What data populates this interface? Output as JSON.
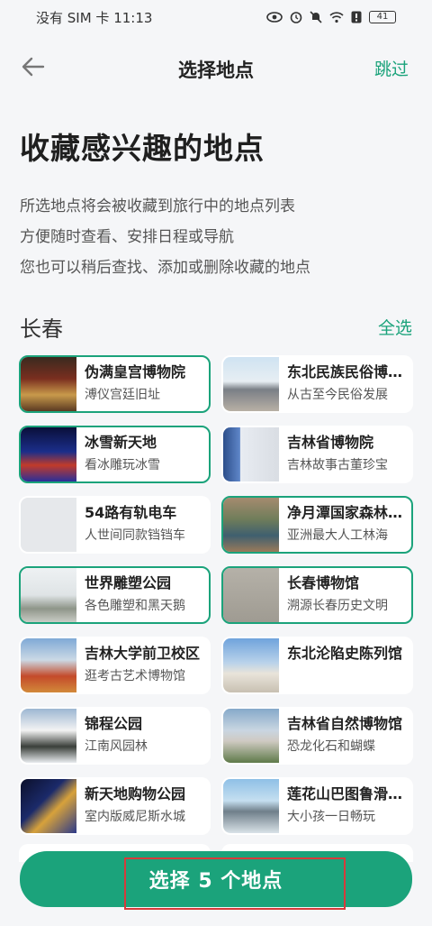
{
  "status": {
    "carrier_time": "没有 SIM 卡 11:13",
    "battery": "41"
  },
  "nav": {
    "title": "选择地点",
    "skip": "跳过"
  },
  "hero": {
    "title": "收藏感兴趣的地点",
    "desc": [
      "所选地点将会被收藏到旅行中的地点列表",
      "方便随时查看、安排日程或导航",
      "您也可以稍后查找、添加或删除收藏的地点"
    ]
  },
  "city": {
    "name": "长春",
    "select_all": "全选"
  },
  "places": [
    {
      "title": "伪满皇宫博物院",
      "sub": "溥仪宫廷旧址",
      "selected": true
    },
    {
      "title": "东北民族民俗博物馆",
      "sub": "从古至今民俗发展",
      "selected": false
    },
    {
      "title": "冰雪新天地",
      "sub": "看冰雕玩冰雪",
      "selected": true
    },
    {
      "title": "吉林省博物院",
      "sub": "吉林故事古董珍宝",
      "selected": false
    },
    {
      "title": "54路有轨电车",
      "sub": "人世间同款铛铛车",
      "selected": false
    },
    {
      "title": "净月潭国家森林公园",
      "sub": "亚洲最大人工林海",
      "selected": true
    },
    {
      "title": "世界雕塑公园",
      "sub": "各色雕塑和黑天鹅",
      "selected": true
    },
    {
      "title": "长春博物馆",
      "sub": "溯源长春历史文明",
      "selected": true
    },
    {
      "title": "吉林大学前卫校区",
      "sub": "逛考古艺术博物馆",
      "selected": false
    },
    {
      "title": "东北沦陷史陈列馆",
      "sub": "",
      "selected": false
    },
    {
      "title": "锦程公园",
      "sub": "江南风园林",
      "selected": false
    },
    {
      "title": "吉林省自然博物馆",
      "sub": "恐龙化石和蝴蝶",
      "selected": false
    },
    {
      "title": "新天地购物公园",
      "sub": "室内版威尼斯水城",
      "selected": false
    },
    {
      "title": "莲花山巴图鲁滑雪场",
      "sub": "大小孩一日畅玩",
      "selected": false
    }
  ],
  "bottom": {
    "button": "选择 5 个地点"
  },
  "colors": {
    "accent": "#1ba37b",
    "highlight": "#d63b3b"
  }
}
